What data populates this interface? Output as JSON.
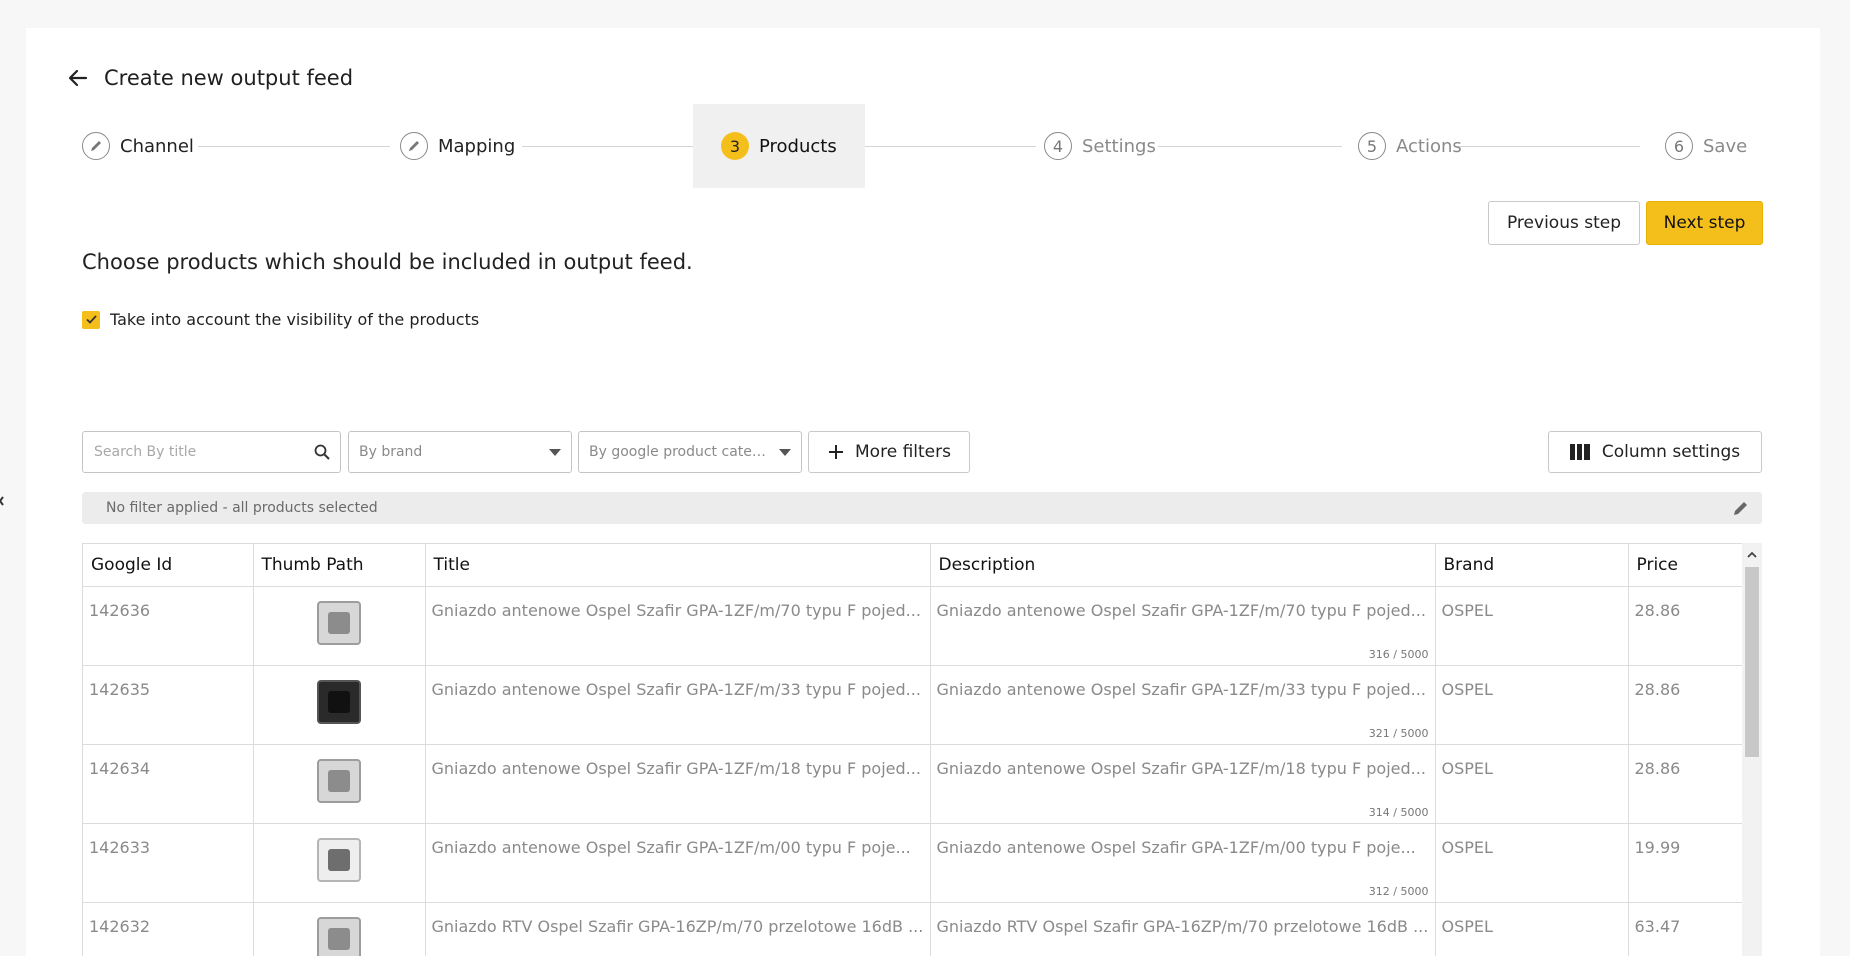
{
  "header": {
    "title": "Create new output feed"
  },
  "steps": [
    {
      "number": "",
      "label": "Channel",
      "state": "done",
      "icon": "pencil-icon"
    },
    {
      "number": "",
      "label": "Mapping",
      "state": "done",
      "icon": "pencil-icon"
    },
    {
      "number": "3",
      "label": "Products",
      "state": "active"
    },
    {
      "number": "4",
      "label": "Settings",
      "state": "inactive"
    },
    {
      "number": "5",
      "label": "Actions",
      "state": "inactive"
    },
    {
      "number": "6",
      "label": "Save",
      "state": "inactive"
    }
  ],
  "actions": {
    "previous_label": "Previous step",
    "next_label": "Next step"
  },
  "instruction": "Choose products which should be included in output feed.",
  "visibility": {
    "label": "Take into account the visibility of the products",
    "checked": true
  },
  "filters": {
    "search_placeholder": "Search By title",
    "brand_placeholder": "By brand",
    "category_placeholder": "By google product categ...",
    "more_filters_label": "More filters",
    "column_settings_label": "Column settings"
  },
  "filter_status": "No filter applied - all products selected",
  "table": {
    "columns": [
      "Google Id",
      "Thumb Path",
      "Title",
      "Description",
      "Brand",
      "Price"
    ],
    "rows": [
      {
        "id": "142636",
        "thumb": "grey",
        "title": "Gniazdo antenowe Ospel Szafir GPA-1ZF/m/70 typu F pojed...",
        "description": "Gniazdo antenowe Ospel Szafir GPA-1ZF/m/70 typu F pojed...",
        "counter": "316 / 5000",
        "brand": "OSPEL",
        "price": "28.86"
      },
      {
        "id": "142635",
        "thumb": "dark",
        "title": "Gniazdo antenowe Ospel Szafir GPA-1ZF/m/33 typu F pojed...",
        "description": "Gniazdo antenowe Ospel Szafir GPA-1ZF/m/33 typu F pojed...",
        "counter": "321 / 5000",
        "brand": "OSPEL",
        "price": "28.86"
      },
      {
        "id": "142634",
        "thumb": "grey",
        "title": "Gniazdo antenowe Ospel Szafir GPA-1ZF/m/18 typu F pojed...",
        "description": "Gniazdo antenowe Ospel Szafir GPA-1ZF/m/18 typu F pojed...",
        "counter": "314 / 5000",
        "brand": "OSPEL",
        "price": "28.86"
      },
      {
        "id": "142633",
        "thumb": "light",
        "title": "Gniazdo antenowe Ospel Szafir GPA-1ZF/m/00 typu F poje...",
        "description": "Gniazdo antenowe Ospel Szafir GPA-1ZF/m/00 typu F poje...",
        "counter": "312 / 5000",
        "brand": "OSPEL",
        "price": "19.99"
      },
      {
        "id": "142632",
        "thumb": "grey",
        "title": "Gniazdo RTV Ospel Szafir GPA-16ZP/m/70 przelotowe 16dB ...",
        "description": "Gniazdo RTV Ospel Szafir GPA-16ZP/m/70 przelotowe 16dB ...",
        "counter": "",
        "brand": "OSPEL",
        "price": "63.47"
      }
    ]
  },
  "colors": {
    "accent": "#f5bf1b",
    "border": "#dcdcdc",
    "muted_text": "#8a8a8a"
  }
}
